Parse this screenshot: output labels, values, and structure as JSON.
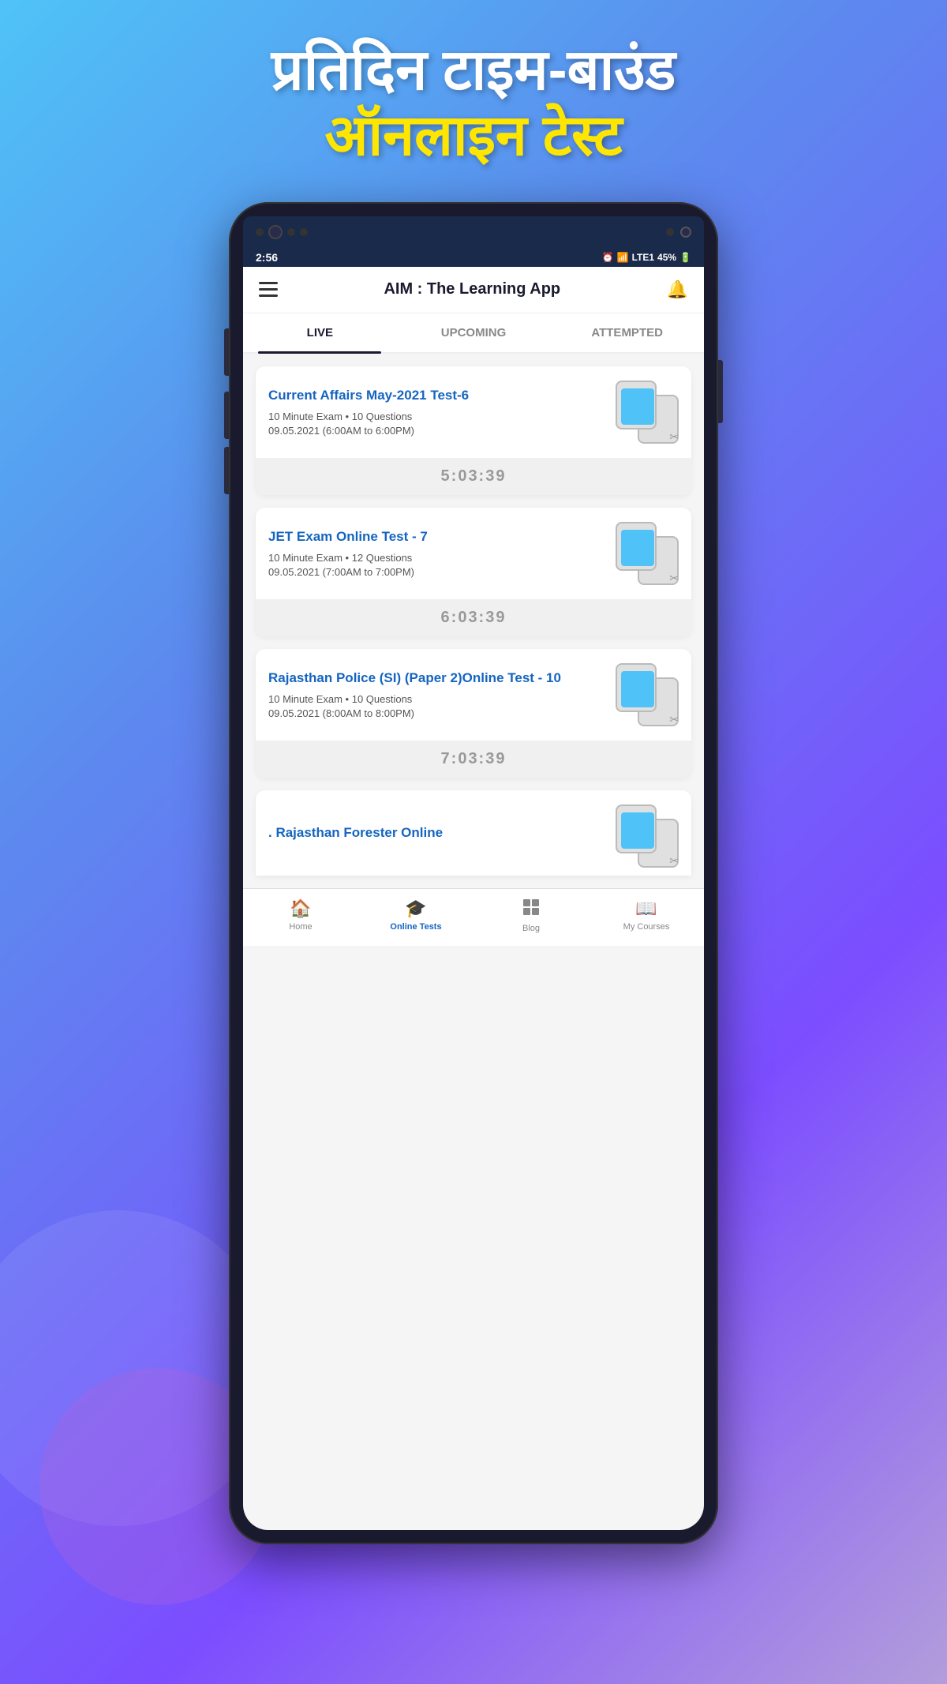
{
  "header": {
    "line1": "प्रतिदिन टाइम-बाउंड",
    "line2": "ऑनलाइन टेस्ट"
  },
  "status_bar": {
    "time": "2:56",
    "battery": "45%",
    "signal": "LTE1"
  },
  "app_header": {
    "title": "AIM : The Learning App"
  },
  "tabs": [
    {
      "label": "LIVE",
      "active": true
    },
    {
      "label": "UPCOMING",
      "active": false
    },
    {
      "label": "ATTEMPTED",
      "active": false
    }
  ],
  "tests": [
    {
      "title": "Current Affairs May-2021 Test-6",
      "meta": "10 Minute Exam • 10 Questions",
      "date": "09.05.2021 (6:00AM to 6:00PM)",
      "timer": "5:03:39"
    },
    {
      "title": "JET Exam Online Test - 7",
      "meta": "10 Minute Exam • 12 Questions",
      "date": "09.05.2021 (7:00AM to 7:00PM)",
      "timer": "6:03:39"
    },
    {
      "title": "Rajasthan Police (SI) (Paper 2)Online Test - 10",
      "meta": "10 Minute Exam • 10 Questions",
      "date": "09.05.2021 (8:00AM to 8:00PM)",
      "timer": "7:03:39"
    },
    {
      "title": ". Rajasthan Forester Online",
      "meta": "",
      "date": "",
      "timer": ""
    }
  ],
  "bottom_nav": [
    {
      "label": "Home",
      "icon": "🏠",
      "active": false
    },
    {
      "label": "Online Tests",
      "icon": "🎓",
      "active": true
    },
    {
      "label": "Blog",
      "icon": "⊞",
      "active": false
    },
    {
      "label": "My Courses",
      "icon": "📖",
      "active": false
    }
  ]
}
